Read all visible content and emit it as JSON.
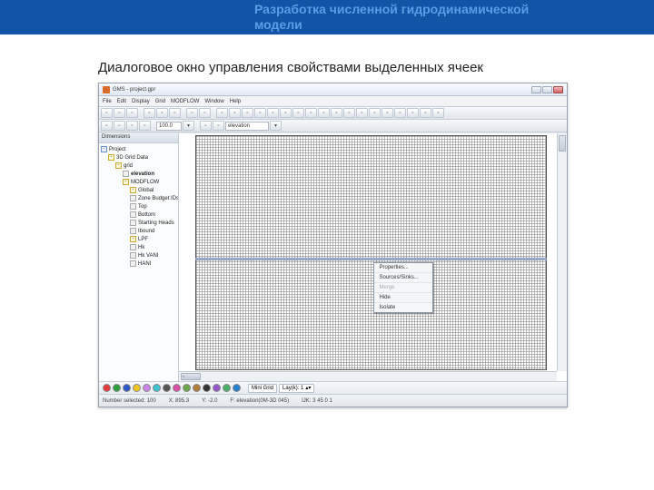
{
  "slide": {
    "header_line1": "Разработка численной гидродинамической",
    "header_line2": "модели",
    "caption": "Диалоговое окно управления свойствами выделенных ячеек"
  },
  "window": {
    "title": "GMS - project.gpr"
  },
  "menu": [
    "File",
    "Edit",
    "Display",
    "Grid",
    "MODFLOW",
    "Window",
    "Help"
  ],
  "toolbar2": {
    "zoom": "100.0",
    "field": "elevation"
  },
  "side_title": "Dimensions",
  "tree": {
    "root": "Project",
    "n1": "3D Grid Data",
    "n2": "grid",
    "n3": "elevation",
    "n4": "MODFLOW",
    "n5": "Global",
    "n6": "Zone Budget IDs",
    "n7": "Top",
    "n8": "Bottom",
    "n9": "Starting Heads",
    "n10": "Ibound",
    "n11": "LPF",
    "n12": "Hk",
    "n13": "Hk VANI",
    "n14": "HANI"
  },
  "context": {
    "m1": "Properties...",
    "m2": "Sources/Sinks...",
    "m3": "Merge",
    "m4": "Hide",
    "m5": "Isolate"
  },
  "footerA": {
    "chip1": "Mini Grid",
    "chip2": "Lay(k): 1"
  },
  "status": {
    "selected": "Number selected: 100",
    "x": "X: 895.3",
    "y": "Y: -2.0",
    "f": "F: elevation(0M-3D 045)",
    "ijk": "IJK: 3 45 0 1"
  },
  "dot_colors": [
    "#e23c3c",
    "#2e9f3c",
    "#2e58c9",
    "#f0c420",
    "#c982e8",
    "#3ec2d4",
    "#555",
    "#d64fa4",
    "#6aa54a",
    "#b07d3b",
    "#333",
    "#9558c9",
    "#49b06a",
    "#2680d1"
  ]
}
